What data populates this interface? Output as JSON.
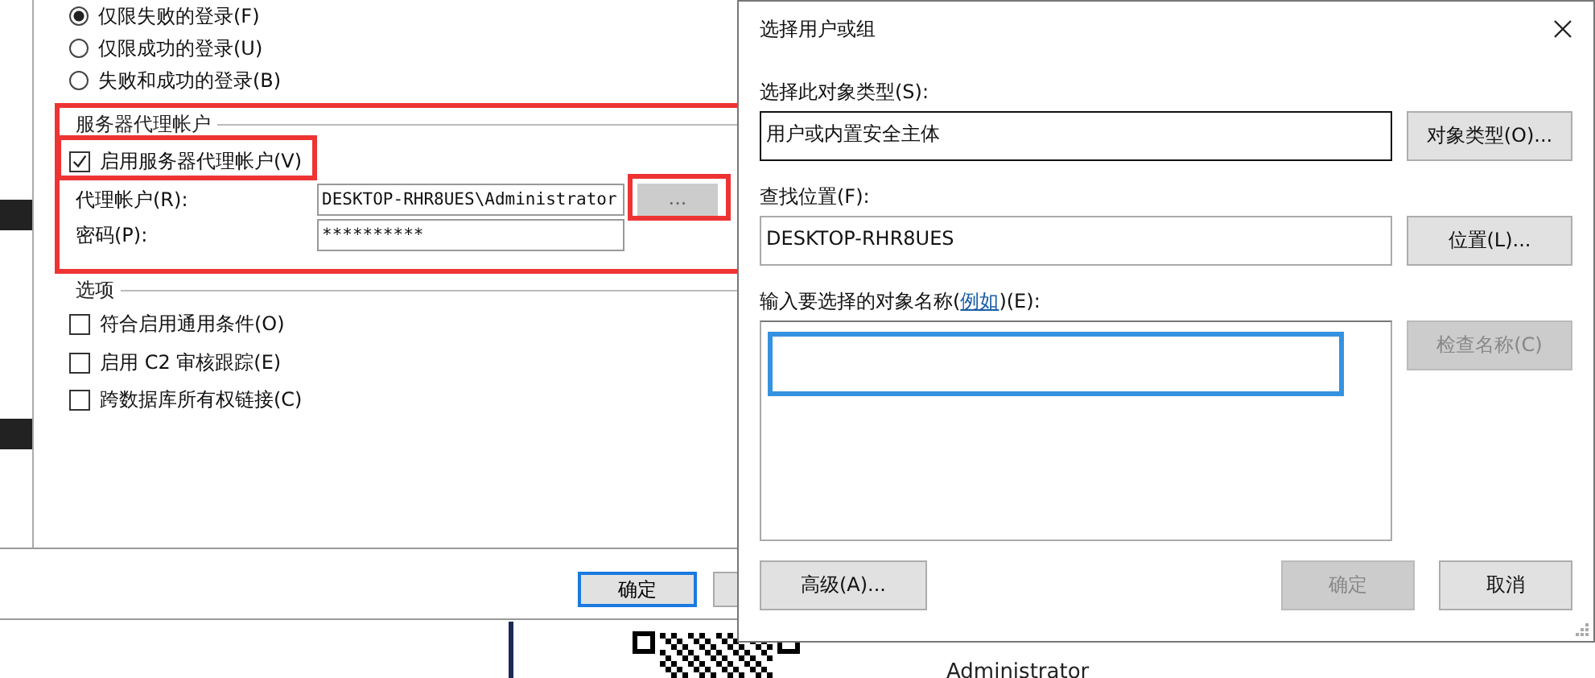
{
  "properties_window": {
    "audit_options": [
      {
        "label": "仅限失败的登录(F)",
        "selected": true
      },
      {
        "label": "仅限成功的登录(U)",
        "selected": false
      },
      {
        "label": "失败和成功的登录(B)",
        "selected": false
      }
    ],
    "proxy_group": {
      "title": "服务器代理帐户",
      "enable": {
        "label": "启用服务器代理帐户(V)",
        "checked": true
      },
      "account_label": "代理帐户(R):",
      "account_value": "DESKTOP-RHR8UES\\Administrator",
      "password_label": "密码(P):",
      "password_value": "**********",
      "browse_button": {
        "label": "...",
        "disabled": true
      }
    },
    "options_group": {
      "title": "选项",
      "items": [
        {
          "label": "符合启用通用条件(O)",
          "checked": false
        },
        {
          "label": "启用 C2 审核跟踪(E)",
          "checked": false
        },
        {
          "label": "跨数据库所有权链接(C)",
          "checked": false
        }
      ]
    },
    "ok_button": "确定"
  },
  "select_dialog": {
    "title": "选择用户或组",
    "object_type_label": "选择此对象类型(S):",
    "object_type_value": "用户或内置安全主体",
    "object_type_button": "对象类型(O)...",
    "location_label": "查找位置(F):",
    "location_value": "DESKTOP-RHR8UES",
    "location_button": "位置(L)...",
    "names_label_before": "输入要选择的对象名称(",
    "names_label_link": "例如",
    "names_label_after": ")(E):",
    "check_button": {
      "label": "检查名称(C)",
      "disabled": true
    },
    "advanced_button": "高级(A)...",
    "ok_button": {
      "label": "确定",
      "disabled": true
    },
    "cancel_button": "取消"
  },
  "background": {
    "user_name": "Administrator"
  }
}
